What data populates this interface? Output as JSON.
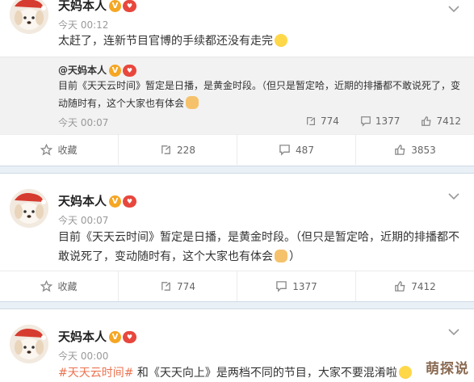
{
  "posts": [
    {
      "author": "天妈本人",
      "badge_v": "V",
      "badge_heart": "♥",
      "time": "今天 00:12",
      "text": "太赶了，连新节目官博的手续都还没有走完",
      "quote": {
        "author": "@天妈本人",
        "text": "目前《天天云时间》暂定是日播，是黄金时段。（但只是暂定哈，近期的排播都不敢说死了，变动随时有，这个大家也有体会",
        "time": "今天 00:07",
        "repost": "774",
        "comment": "1377",
        "like": "7412"
      },
      "footer": {
        "fav": "收藏",
        "repost": "228",
        "comment": "487",
        "like": "3853"
      }
    },
    {
      "author": "天妈本人",
      "badge_v": "V",
      "badge_heart": "♥",
      "time": "今天 00:07",
      "text": "目前《天天云时间》暂定是日播，是黄金时段。（但只是暂定哈，近期的排播都不敢说死了，变动随时有，这个大家也有体会",
      "text_tail": "）",
      "footer": {
        "fav": "收藏",
        "repost": "774",
        "comment": "1377",
        "like": "7412"
      }
    },
    {
      "author": "天妈本人",
      "badge_v": "V",
      "badge_heart": "♥",
      "time": "今天 00:00",
      "topic": "#天天云时间#",
      "text": " 和《天天向上》是两档不同的节目，大家不要混淆啦"
    }
  ],
  "watermark": "萌探说",
  "icons": {
    "favorite": "star-icon",
    "repost": "repost-icon",
    "comment": "comment-icon",
    "like": "thumbs-up-icon",
    "menu": "chevron-down-icon"
  },
  "colors": {
    "topic": "#eb7350",
    "divider": "#e9f0f6",
    "quote_bg": "#f2f2f2"
  }
}
